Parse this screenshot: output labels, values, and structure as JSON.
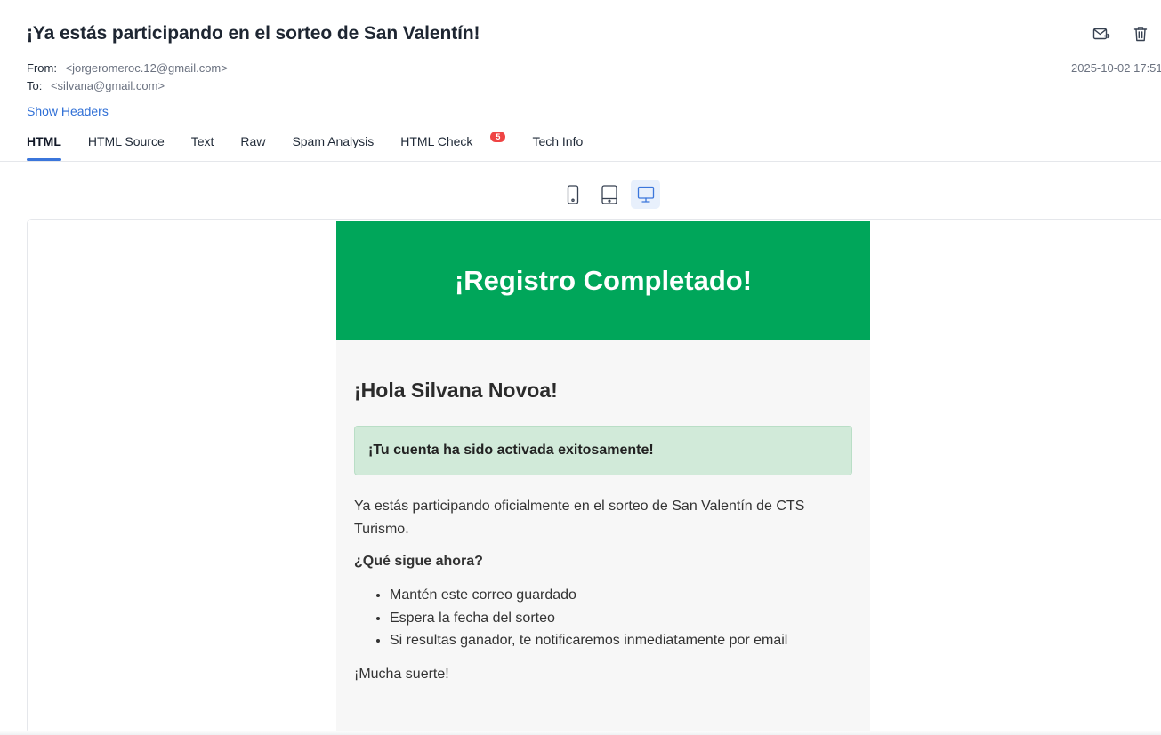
{
  "message": {
    "subject": "¡Ya estás participando en el sorteo de San Valentín!",
    "from_label": "From:",
    "from_value": "<jorgeromeroc.12@gmail.com>",
    "to_label": "To:",
    "to_value": "<silvana@gmail.com>",
    "date": "2025-10-02 17:51",
    "show_headers": "Show Headers"
  },
  "actions": {
    "forward_icon": "mail-forward-icon",
    "delete_icon": "trash-icon"
  },
  "tabs": [
    {
      "label": "HTML",
      "active": true
    },
    {
      "label": "HTML Source"
    },
    {
      "label": "Text"
    },
    {
      "label": "Raw"
    },
    {
      "label": "Spam Analysis"
    },
    {
      "label": "HTML Check",
      "badge": "5"
    },
    {
      "label": "Tech Info"
    }
  ],
  "devices": [
    {
      "name": "mobile",
      "icon": "phone-icon"
    },
    {
      "name": "tablet",
      "icon": "tablet-icon"
    },
    {
      "name": "desktop",
      "icon": "desktop-icon",
      "active": true
    }
  ],
  "email": {
    "header_title": "¡Registro Completado!",
    "greeting": "¡Hola Silvana Novoa!",
    "alert": "¡Tu cuenta ha sido activada exitosamente!",
    "paragraph": "Ya estás participando oficialmente en el sorteo de San Valentín de CTS Turismo.",
    "next_heading": "¿Qué sigue ahora?",
    "items": [
      "Mantén este correo guardado",
      "Espera la fecha del sorteo",
      "Si resultas ganador, te notificaremos inmediatamente por email"
    ],
    "closing": "¡Mucha suerte!"
  },
  "colors": {
    "accent": "#3b76db",
    "link": "#2f6fd6",
    "badge": "#ef4444",
    "email_header": "#00a65a",
    "alert_bg": "#d1ead9"
  }
}
